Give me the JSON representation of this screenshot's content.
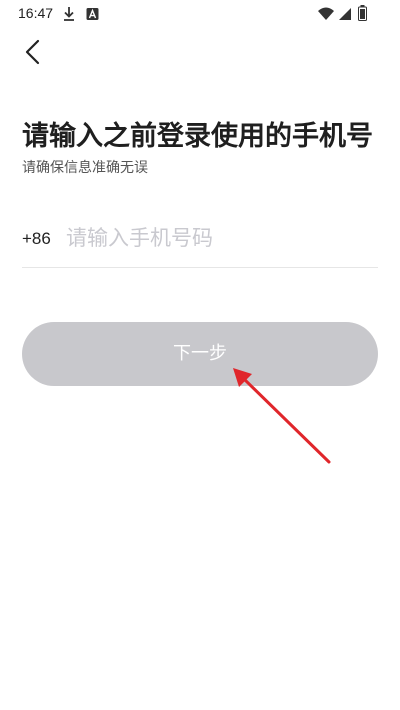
{
  "status_bar": {
    "time": "16:47",
    "icons": [
      "download-icon",
      "a-badge-icon",
      "wifi-icon",
      "cellular-signal-icon",
      "battery-icon"
    ]
  },
  "header": {
    "back_icon": "chevron-left-icon"
  },
  "main": {
    "title": "请输入之前登录使用的手机号",
    "subtitle": "请确保信息准确无误",
    "phone": {
      "country_code": "+86",
      "placeholder": "请输入手机号码",
      "value": ""
    },
    "next_button_label": "下一步"
  },
  "colors": {
    "button_disabled": "#c8c8cc",
    "placeholder": "#c9c9cf",
    "annotation_arrow": "#e0262b"
  }
}
